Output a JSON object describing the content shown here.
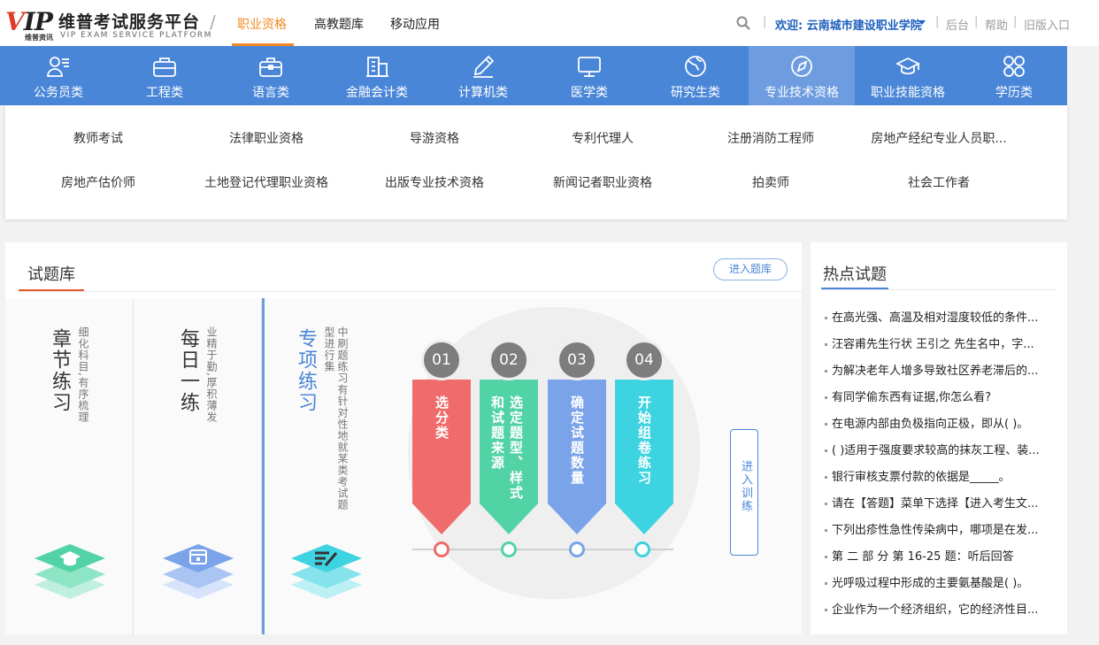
{
  "header": {
    "logo_main": "VIP",
    "logo_sub": "维普资讯",
    "logo_title": "维普考试服务平台",
    "logo_en": "VIP EXAM  SERVICE PLATFORM",
    "nav": [
      "职业资格",
      "高教题库",
      "移动应用"
    ],
    "welcome": "欢迎: 云南城市建设职业学院",
    "links": [
      "后台",
      "帮助",
      "旧版入口"
    ],
    "accent_color": "#f08a24",
    "brand_blue": "#4a86d8"
  },
  "categories": [
    {
      "label": "公务员类",
      "icon": "person-list-icon"
    },
    {
      "label": "工程类",
      "icon": "toolbox-icon"
    },
    {
      "label": "语言类",
      "icon": "briefcase-icon"
    },
    {
      "label": "金融会计类",
      "icon": "building-icon"
    },
    {
      "label": "计算机类",
      "icon": "pencil-icon"
    },
    {
      "label": "医学类",
      "icon": "monitor-icon"
    },
    {
      "label": "研究生类",
      "icon": "globe-icon"
    },
    {
      "label": "专业技术资格",
      "icon": "compass-icon"
    },
    {
      "label": "职业技能资格",
      "icon": "graduation-cap-icon"
    },
    {
      "label": "学历类",
      "icon": "grid-icon"
    }
  ],
  "subcategories": [
    [
      "教师考试",
      "法律职业资格",
      "导游资格",
      "专利代理人",
      "注册消防工程师",
      "房地产经纪专业人员职..."
    ],
    [
      "房地产估价师",
      "土地登记代理职业资格",
      "出版专业技术资格",
      "新闻记者职业资格",
      "拍卖师",
      "社会工作者"
    ]
  ],
  "bank": {
    "title": "试题库",
    "enter_label": "进入题库",
    "modes": [
      {
        "title": "章节练习",
        "desc": "细化科目,有序梳理"
      },
      {
        "title": "每日一练",
        "desc": "业精于勤,厚积薄发"
      },
      {
        "title": "专项练习",
        "desc": "中刷题练习有针对性地就某类考试题型进行集"
      }
    ],
    "steps": [
      {
        "num": "01",
        "text": "选分类",
        "color": "#f06b6b"
      },
      {
        "num": "02",
        "text": "选定题型、样式和试题来源",
        "color": "#52d3a5"
      },
      {
        "num": "03",
        "text": "确定试题数量",
        "color": "#7aa3ea"
      },
      {
        "num": "04",
        "text": "开始组卷练习",
        "color": "#3dd3e1"
      }
    ],
    "enter_train": "进入训练"
  },
  "hot": {
    "title": "热点试题",
    "items": [
      "在高光强、高温及相对湿度较低的条件...",
      "汪容甫先生行状 王引之 先生名中，字...",
      "为解决老年人增多导致社区养老滞后的...",
      "有同学偷东西有证据,你怎么看?",
      "在电源内部由负极指向正极，即从( )。",
      "( )适用于强度要求较高的抹灰工程、装...",
      "银行审核支票付款的依据是_____。",
      "请在【答题】菜单下选择【进入考生文...",
      "下列出疹性急性传染病中，哪项是在发...",
      "第 二 部 分 第 16-25 题：听后回答",
      "光呼吸过程中形成的主要氨基酸是( )。",
      "企业作为一个经济组织，它的经济性目..."
    ]
  }
}
